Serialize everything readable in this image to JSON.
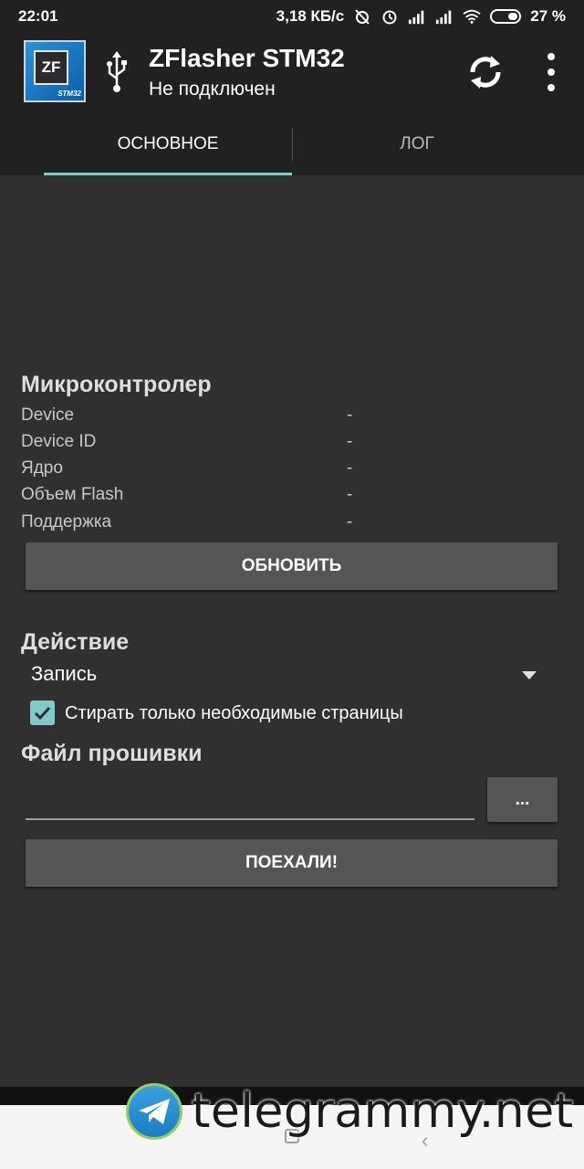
{
  "status_bar": {
    "time": "22:01",
    "network_speed": "3,18 КБ/с",
    "battery": "27 %",
    "icons": [
      "alarm-off-icon",
      "alarm-icon",
      "signal-icon",
      "signal-icon",
      "wifi-icon",
      "battery-icon"
    ]
  },
  "app_bar": {
    "title": "ZFlasher STM32",
    "subtitle": "Не подключен",
    "logo_text": "ZF",
    "logo_tag": "STM32"
  },
  "tabs": [
    {
      "label": "ОСНОВНОЕ",
      "selected": true
    },
    {
      "label": "ЛОГ",
      "selected": false
    }
  ],
  "mcu": {
    "title": "Микроконтролер",
    "rows": [
      {
        "label": "Device",
        "value": "-"
      },
      {
        "label": "Device ID",
        "value": "-"
      },
      {
        "label": "Ядро",
        "value": "-"
      },
      {
        "label": "Объем Flash",
        "value": "-"
      },
      {
        "label": "Поддержка",
        "value": "-"
      }
    ],
    "refresh_button": "ОБНОВИТЬ"
  },
  "action": {
    "title": "Действие",
    "selected": "Запись",
    "checkbox_label": "Стирать только необходимые страницы",
    "checkbox_checked": true
  },
  "firmware": {
    "title": "Файл прошивки",
    "file_value": "",
    "browse_button": "...",
    "go_button": "ПОЕХАЛИ!"
  },
  "watermark": {
    "text": "telegrammy.net"
  },
  "colors": {
    "accent": "#80cbc4",
    "toolbar": "#212121",
    "background": "#303030",
    "button": "#555555"
  }
}
